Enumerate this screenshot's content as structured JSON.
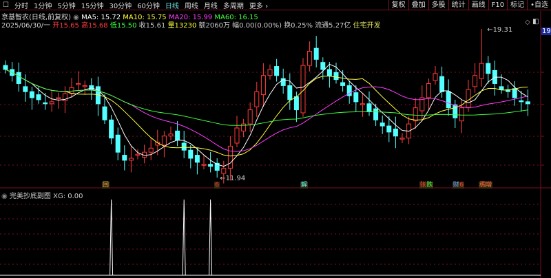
{
  "toolbar": {
    "tabs": [
      "分时",
      "1分钟",
      "5分钟",
      "15分钟",
      "30分钟",
      "60分钟",
      "日线",
      "周线",
      "月线",
      "多周期",
      "更多 ›"
    ],
    "active": "日线",
    "right_buttons": [
      "复权",
      "叠加",
      "多股",
      "统计",
      "画线",
      "F10",
      "标记",
      "•自选"
    ]
  },
  "stock": {
    "name": "京基智农(日线,前复权)",
    "ma5": "MA5: 15.72",
    "ma10": "MA10: 15.75",
    "ma20": "MA20: 15.99",
    "ma60": "MA60: 16.15",
    "date": "2025/06/30/一",
    "open": "开15.65",
    "high": "高15.68",
    "low": "低15.50",
    "close": "收15.61",
    "volume": "量13230",
    "amount": "额2060万",
    "change": "幅0.00(0.00%)",
    "turnover": "换0.25%",
    "float_cap": "流通5.27亿",
    "industry": "住宅开发"
  },
  "colors": {
    "up": "#ff3c3c",
    "down": "#54ffff",
    "ma5": "#ffffff",
    "ma10": "#ffff3c",
    "ma20": "#ff3cff",
    "ma60": "#3cff3c",
    "grid": "#7a1020"
  },
  "chart_data": {
    "type": "candlestick",
    "closes": [
      17.3,
      17.0,
      16.6,
      16.2,
      15.9,
      15.8,
      15.6,
      15.7,
      15.9,
      16.1,
      16.4,
      16.6,
      16.5,
      16.3,
      15.6,
      14.8,
      13.9,
      13.2,
      12.8,
      12.9,
      13.1,
      13.2,
      13.4,
      13.7,
      14.0,
      14.1,
      13.8,
      13.3,
      12.9,
      12.7,
      12.6,
      12.5,
      12.3,
      12.4,
      13.5,
      14.4,
      14.6,
      15.3,
      16.2,
      17.0,
      17.3,
      17.0,
      16.5,
      15.8,
      15.3,
      17.5,
      18.2,
      17.8,
      17.3,
      17.0,
      16.8,
      16.5,
      16.0,
      15.7,
      15.6,
      15.2,
      14.8,
      14.5,
      14.2,
      14.0,
      13.9,
      14.6,
      15.4,
      15.9,
      16.6,
      17.1,
      16.2,
      15.4,
      14.9,
      15.4,
      16.3,
      17.0,
      17.6,
      17.1,
      16.6,
      16.3,
      16.2,
      15.9,
      15.7,
      15.6
    ],
    "high_label": "19.31",
    "high_index": 72,
    "low_label": "11.94",
    "low_index": 32,
    "axis_top_label": "19.0"
  },
  "markers": [
    {
      "text": "回",
      "color": "#e0b040",
      "index": 15
    },
    {
      "text": "6",
      "color": "#ff3c3c",
      "index": 32
    },
    {
      "text": "解",
      "color": "#54ffff",
      "index": 45
    },
    {
      "text": "张",
      "color": "#ff3c3c",
      "index": 63
    },
    {
      "text": "跌",
      "color": "#3cff3c",
      "index": 64
    },
    {
      "text": "财",
      "color": "#5aa0ff",
      "index": 68
    },
    {
      "text": "6",
      "color": "#ff3c3c",
      "index": 69
    },
    {
      "text": "稠增",
      "color": "#ff7040",
      "index": 72
    }
  ],
  "indicator": {
    "title": "完美抄底副图",
    "value": "XG: 0.00",
    "signals": [
      16,
      27,
      31
    ]
  }
}
